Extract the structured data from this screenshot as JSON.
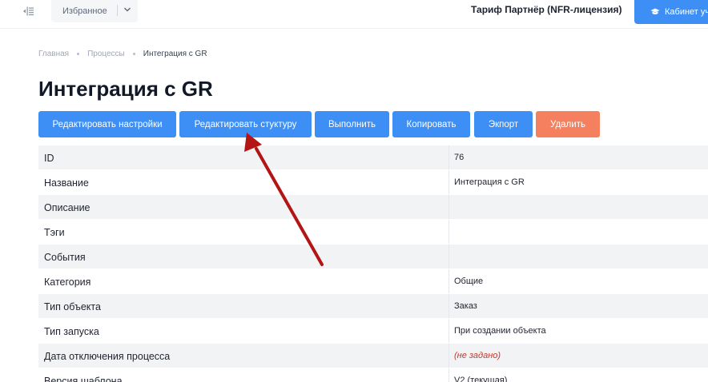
{
  "topbar": {
    "favorites_label": "Избранное",
    "tariff_label": "Тариф Партнёр (NFR-лицензия)",
    "cabinet_label": "Кабинет уч"
  },
  "breadcrumb": {
    "items": [
      "Главная",
      "Процессы"
    ],
    "current": "Интеграция с GR"
  },
  "page": {
    "title": "Интеграция с GR"
  },
  "actions": {
    "edit_settings": "Редактировать настройки",
    "edit_structure": "Редактировать стуктуру",
    "run": "Выполнить",
    "copy": "Копировать",
    "export": "Экпорт",
    "delete": "Удалить"
  },
  "details": {
    "rows": [
      {
        "key": "ID",
        "value": "76"
      },
      {
        "key": "Название",
        "value": "Интеграция с GR"
      },
      {
        "key": "Описание",
        "value": ""
      },
      {
        "key": "Тэги",
        "value": ""
      },
      {
        "key": "События",
        "value": ""
      },
      {
        "key": "Категория",
        "value": "Общие"
      },
      {
        "key": "Тип объекта",
        "value": "Заказ"
      },
      {
        "key": "Тип запуска",
        "value": "При создании объекта"
      },
      {
        "key": "Дата отключения процесса",
        "value": "(не задано)"
      },
      {
        "key": "Версия шаблона",
        "value": "V2 (текущая)"
      }
    ]
  },
  "colors": {
    "primary": "#3d8ef5",
    "danger": "#f5805f",
    "row_stripe": "#f2f3f5",
    "annotation_arrow": "#b31414",
    "not_set_text": "#c0392b"
  }
}
